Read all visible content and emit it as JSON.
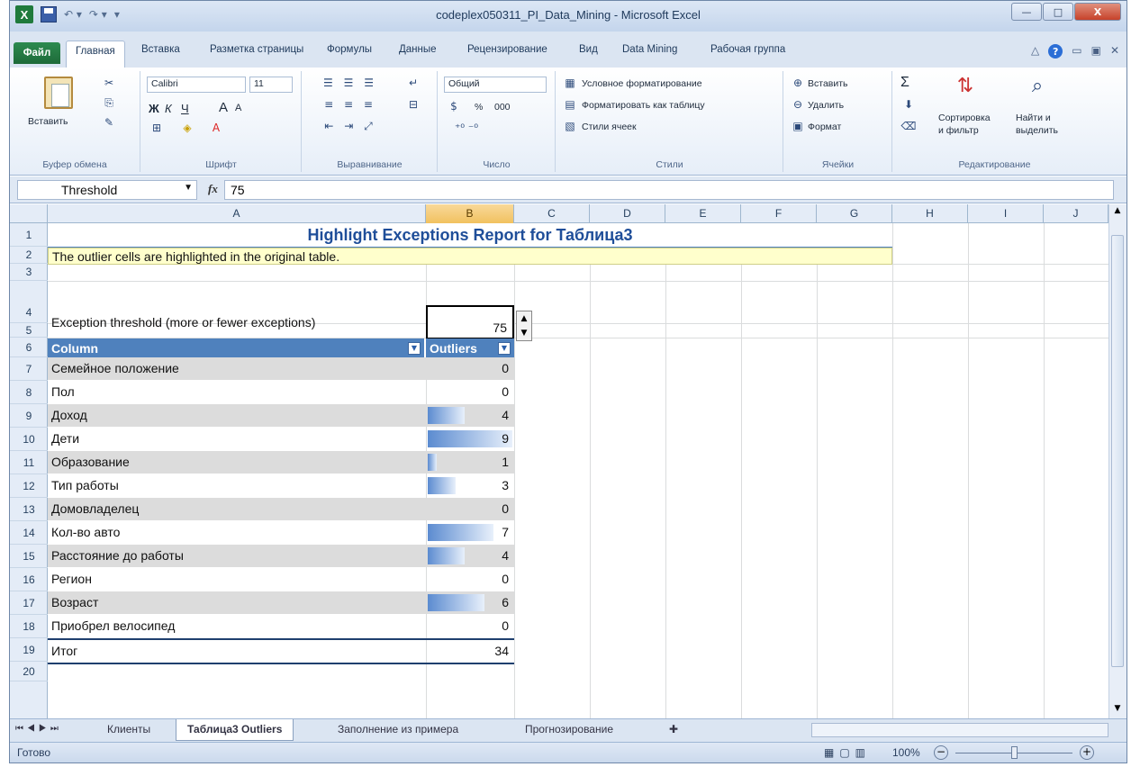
{
  "window": {
    "title": "codeplex050311_PI_Data_Mining - Microsoft Excel",
    "app_icon": "X",
    "buttons": [
      "—",
      "□",
      "X"
    ]
  },
  "tabs": {
    "file": "Файл",
    "home": "Главная",
    "insert": "Вставка",
    "layout": "Разметка страницы",
    "formulas": "Формулы",
    "data": "Данные",
    "review": "Рецензирование",
    "view": "Вид",
    "datamining": "Data Mining",
    "workgroup": "Рабочая группа"
  },
  "ribbon": {
    "clipboard": {
      "paste": "Вставить",
      "label": "Буфер обмена"
    },
    "font": {
      "name": "Calibri",
      "size": "11",
      "bold": "Ж",
      "italic": "К",
      "underline": "Ч",
      "grow": "A",
      "shrink": "A",
      "label": "Шрифт"
    },
    "alignment": {
      "label": "Выравнивание"
    },
    "number": {
      "format": "Общий",
      "percent": "%",
      "thousands": "000",
      "label": "Число"
    },
    "styles": {
      "conditional": "Условное форматирование",
      "as_table": "Форматировать как таблицу",
      "cell_styles": "Стили ячеек",
      "label": "Стили"
    },
    "cells": {
      "insert": "Вставить",
      "delete": "Удалить",
      "format": "Формат",
      "label": "Ячейки"
    },
    "editing": {
      "sum": "Σ",
      "sort1": "Сортировка",
      "sort2": "и фильтр",
      "find1": "Найти и",
      "find2": "выделить",
      "label": "Редактирование"
    }
  },
  "formula": {
    "name_box": "Threshold",
    "fx": "fx",
    "value": "75"
  },
  "columns": [
    "A",
    "B",
    "C",
    "D",
    "E",
    "F",
    "G",
    "H",
    "I",
    "J"
  ],
  "rows": [
    "1",
    "2",
    "3",
    "4",
    "5",
    "6",
    "7",
    "8",
    "9",
    "10",
    "11",
    "12",
    "13",
    "14",
    "15",
    "16",
    "17",
    "18",
    "19",
    "20"
  ],
  "sheet": {
    "title": "Highlight Exceptions Report for Таблица3",
    "note": "The outlier cells are highlighted in the original table.",
    "threshold_label": "Exception threshold (more or fewer exceptions)",
    "threshold_value": "75",
    "header_column": "Column",
    "header_outliers": "Outliers",
    "items": [
      {
        "name": "Семейное положение",
        "value": "0",
        "bar": 0
      },
      {
        "name": "Пол",
        "value": "0",
        "bar": 0
      },
      {
        "name": "Доход",
        "value": "4",
        "bar": 0.44
      },
      {
        "name": "Дети",
        "value": "9",
        "bar": 1.0
      },
      {
        "name": "Образование",
        "value": "1",
        "bar": 0.11
      },
      {
        "name": "Тип работы",
        "value": "3",
        "bar": 0.33
      },
      {
        "name": "Домовладелец",
        "value": "0",
        "bar": 0
      },
      {
        "name": "Кол-во авто",
        "value": "7",
        "bar": 0.78
      },
      {
        "name": "Расстояние до работы",
        "value": "4",
        "bar": 0.44
      },
      {
        "name": "Регион",
        "value": "0",
        "bar": 0
      },
      {
        "name": "Возраст",
        "value": "6",
        "bar": 0.67
      },
      {
        "name": "Приобрел велосипед",
        "value": "0",
        "bar": 0
      }
    ],
    "total_label": "Итог",
    "total_value": "34"
  },
  "sheet_tabs": [
    "Клиенты",
    "Таблица3 Outliers",
    "Заполнение из примера",
    "Прогнозирование"
  ],
  "status": {
    "ready": "Готово",
    "zoom": "100%",
    "minus": "−",
    "plus": "+"
  },
  "colors": {
    "accent": "#2a5ea8",
    "header_fill": "#4f81bd",
    "stripe": "#dcdcdc",
    "note_fill": "#ffffcc",
    "bar": "#5b8bd0"
  }
}
